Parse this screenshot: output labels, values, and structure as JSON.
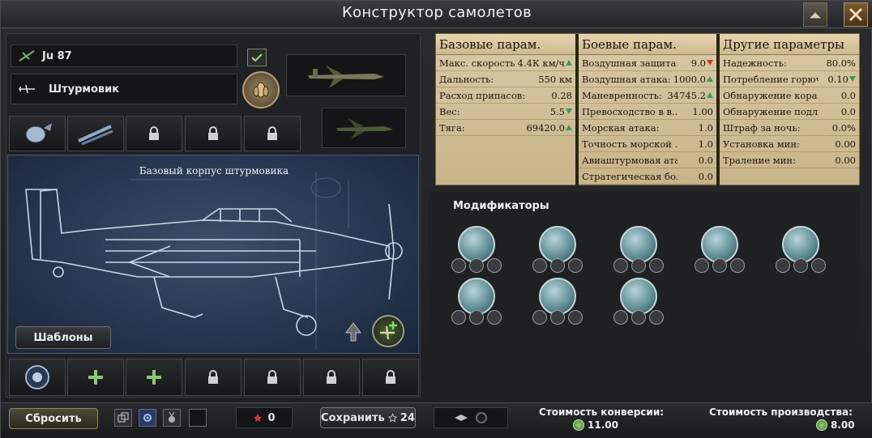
{
  "window": {
    "title": "Конструктор самолетов"
  },
  "design": {
    "name": "Ju 87",
    "role": "Штурмовик",
    "hull_name": "Базовый корпус штурмовика",
    "templates_label": "Шаблоны"
  },
  "stats": {
    "base": {
      "header": "Базовые парам.",
      "rows": [
        {
          "label": "Макс. скорость",
          "value": "4.4К км/ч",
          "trend": "up"
        },
        {
          "label": "Дальность:",
          "value": "550 км",
          "trend": ""
        },
        {
          "label": "Расход припасов:",
          "value": "0.28",
          "trend": ""
        },
        {
          "label": "Вес:",
          "value": "5.5",
          "trend": "down-good"
        },
        {
          "label": "Тяга:",
          "value": "69420.0",
          "trend": "up"
        }
      ]
    },
    "combat": {
      "header": "Боевые парам.",
      "rows": [
        {
          "label": "Воздушная защита:",
          "value": "9.0",
          "trend": "down"
        },
        {
          "label": "Воздушная атака:",
          "value": "1000.0",
          "trend": "up"
        },
        {
          "label": "Маневренность:",
          "value": "34745.2",
          "trend": "up"
        },
        {
          "label": "Превосходство в в...",
          "value": "1.00",
          "trend": ""
        },
        {
          "label": "Морская атака:",
          "value": "1.0",
          "trend": ""
        },
        {
          "label": "Точность морской ...",
          "value": "1.0",
          "trend": ""
        },
        {
          "label": "Авиаштурмовая ата...",
          "value": "0.0",
          "trend": ""
        },
        {
          "label": "Стратегическая бо...",
          "value": "0.0",
          "trend": ""
        }
      ]
    },
    "other": {
      "header": "Другие параметры",
      "rows": [
        {
          "label": "Надежность:",
          "value": "80.0%",
          "trend": ""
        },
        {
          "label": "Потребление горюч...",
          "value": "0.10",
          "trend": "down-good"
        },
        {
          "label": "Обнаружение кора...",
          "value": "0.0",
          "trend": ""
        },
        {
          "label": "Обнаружение подл...",
          "value": "0.0",
          "trend": ""
        },
        {
          "label": "Штраф за ночь:",
          "value": "0.0%",
          "trend": ""
        },
        {
          "label": "Установка мин:",
          "value": "0.00",
          "trend": ""
        },
        {
          "label": "Траление мин:",
          "value": "0.00",
          "trend": ""
        }
      ]
    }
  },
  "modifiers": {
    "label": "Модификаторы"
  },
  "bottom": {
    "reset_label": "Сбросить",
    "counter_value": "0",
    "save_label": "Сохранить",
    "save_cost": "24",
    "conversion_label": "Стоимость конверсии:",
    "conversion_value": "11.00",
    "production_label": "Стоимость производства:",
    "production_value": "8.00"
  },
  "colors": {
    "accent_green": "#3a9a5a",
    "accent_red": "#c83a2a",
    "paper": "#d9c9a4",
    "blueprint": "#2f4260"
  }
}
